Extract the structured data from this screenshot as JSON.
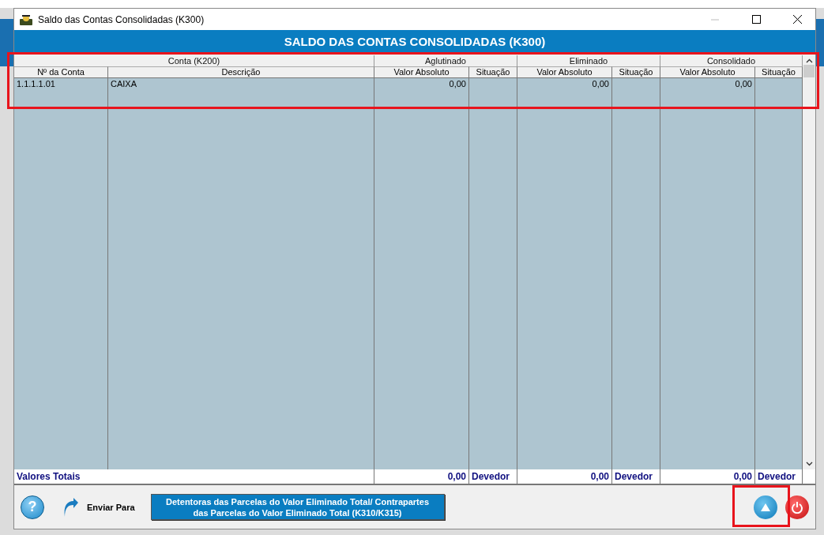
{
  "window": {
    "title": "Saldo das Contas Consolidadas (K300)"
  },
  "header": "SALDO DAS CONTAS CONSOLIDADAS (K300)",
  "table": {
    "groups": [
      "Conta (K200)",
      "Aglutinado",
      "Eliminado",
      "Consolidado"
    ],
    "columns": [
      "Nº da Conta",
      "Descrição",
      "Valor Absoluto",
      "Situação",
      "Valor Absoluto",
      "Situação",
      "Valor Absoluto",
      "Situação"
    ],
    "rows": [
      {
        "cells": [
          "1.1.1.1.01",
          "CAIXA",
          "0,00",
          "",
          "0,00",
          "",
          "0,00",
          ""
        ]
      }
    ],
    "totals": {
      "label": "Valores Totais",
      "cells": [
        "0,00",
        "Devedor",
        "0,00",
        "Devedor",
        "0,00",
        "Devedor"
      ]
    }
  },
  "toolbar": {
    "help_label": "?",
    "send_label": "Enviar Para",
    "action_button": "Detentoras das Parcelas  do Valor Eliminado Total/ Contrapartes das Parcelas do Valor Eliminado Total (K310/K315)"
  }
}
